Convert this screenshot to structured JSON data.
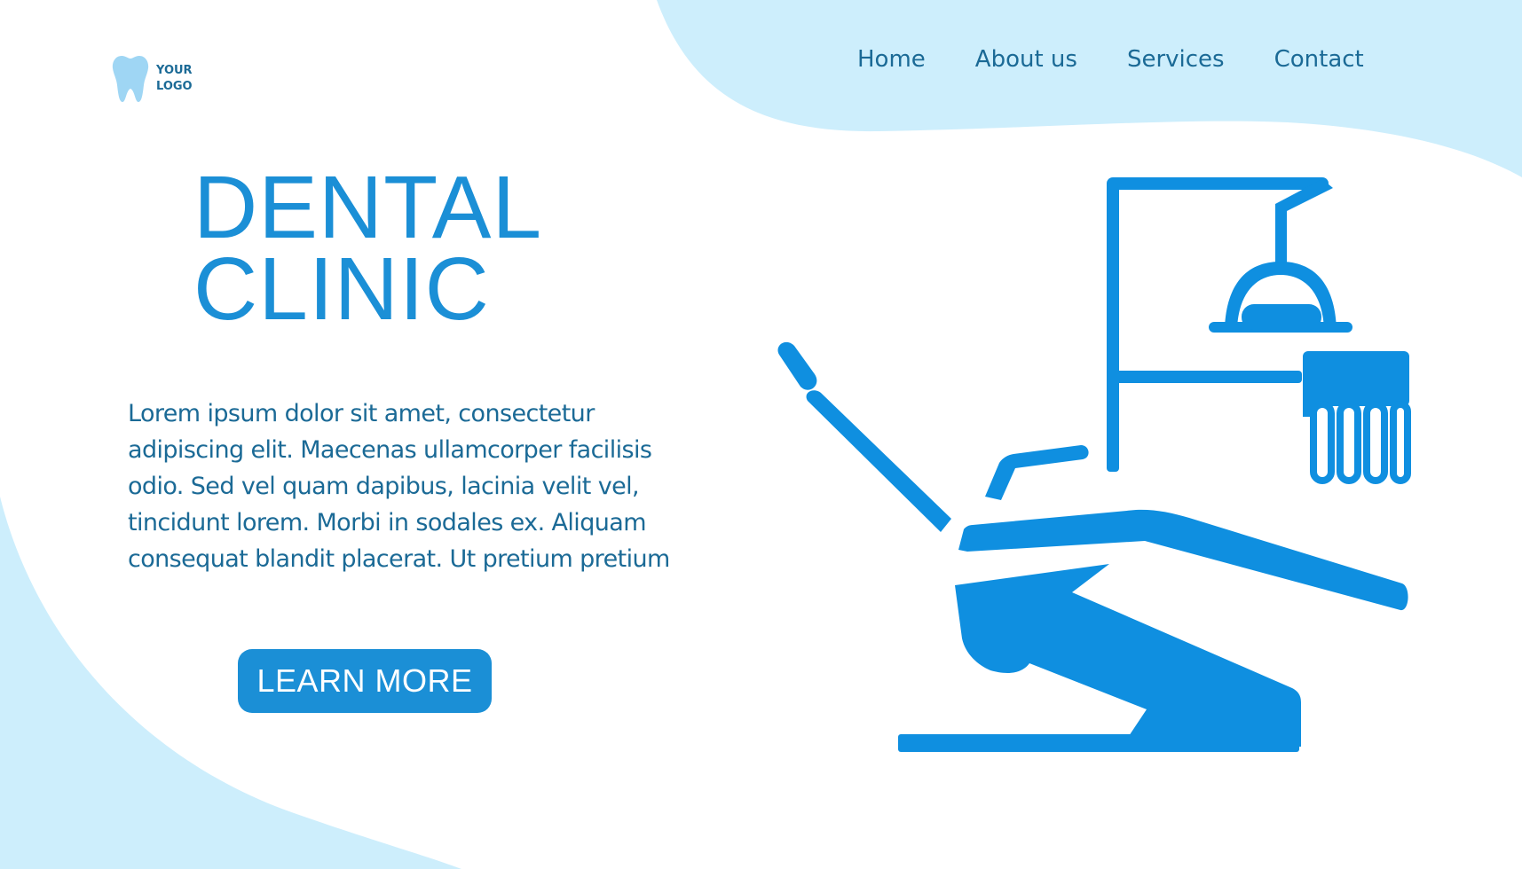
{
  "logo": {
    "line1": "YOUR",
    "line2": "LOGO",
    "icon": "tooth-icon"
  },
  "nav": {
    "items": [
      {
        "label": "Home"
      },
      {
        "label": "About us"
      },
      {
        "label": "Services"
      },
      {
        "label": "Contact"
      }
    ]
  },
  "hero": {
    "title_line1": "DENTAL",
    "title_line2": "CLINIC",
    "body_lines": [
      "Lorem ipsum dolor sit amet, consectetur",
      "adipiscing elit. Maecenas ullamcorper facilisis",
      "odio. Sed vel quam dapibus, lacinia velit vel,",
      "tincidunt lorem. Morbi in sodales ex. Aliquam",
      "consequat blandit placerat. Ut pretium pretium"
    ],
    "cta_label": "LEARN MORE"
  },
  "illustration": {
    "icon": "dental-chair-icon"
  },
  "colors": {
    "accent": "#1b8fd6",
    "text": "#1b6a96",
    "blob": "#cdeefc",
    "background": "#ffffff"
  }
}
